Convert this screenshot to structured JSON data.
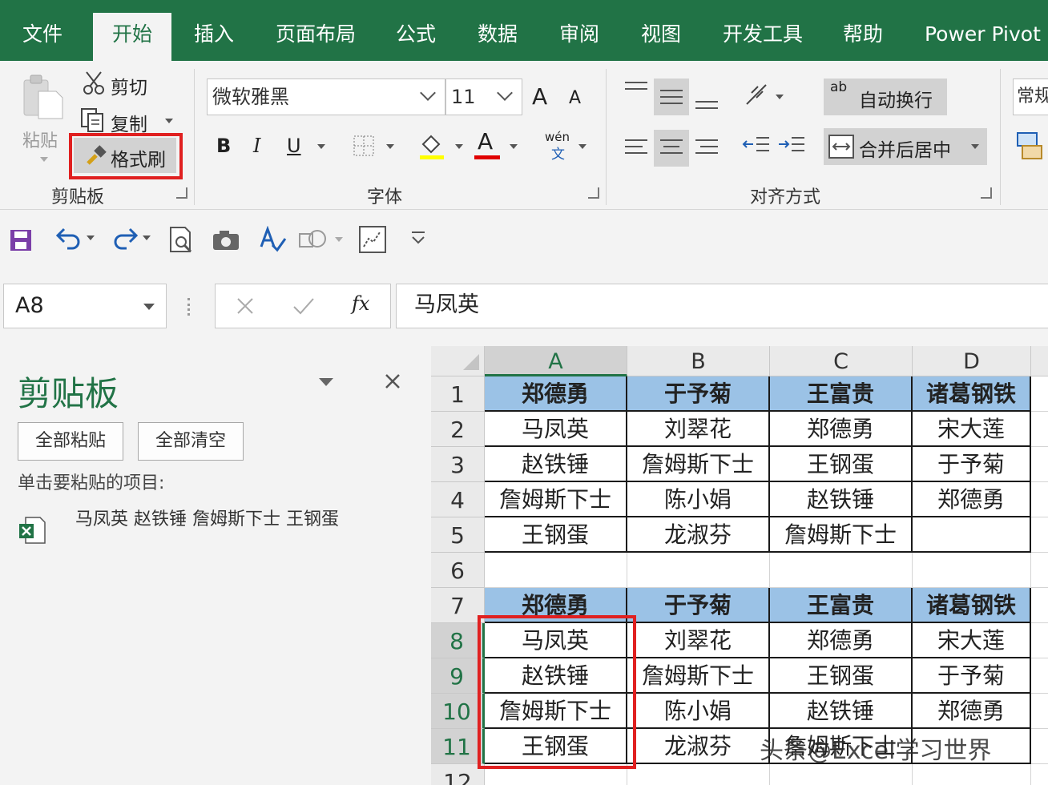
{
  "ribbon_tabs": [
    "文件",
    "开始",
    "插入",
    "页面布局",
    "公式",
    "数据",
    "审阅",
    "视图",
    "开发工具",
    "帮助",
    "Power Pivot"
  ],
  "active_tab": "开始",
  "clipboard_group": {
    "paste_label": "粘贴",
    "cut_label": "剪切",
    "copy_label": "复制",
    "format_painter_label": "格式刷",
    "group_label": "剪贴板"
  },
  "font_group": {
    "font_name": "微软雅黑",
    "font_size": "11",
    "grow_font": "A",
    "shrink_font": "A",
    "bold": "B",
    "italic": "I",
    "underline": "U",
    "phonetic": "wén",
    "phonetic_char": "文",
    "fill_color": "#ffff00",
    "font_color": "#e00000",
    "font_color_letter": "A",
    "group_label": "字体"
  },
  "alignment_group": {
    "wrap_text_label": "自动换行",
    "wrap_icon_text": "ab",
    "merge_center_label": "合并后居中",
    "group_label": "对齐方式"
  },
  "number_group": {
    "format_label": "常规"
  },
  "name_box": "A8",
  "formula_bar": {
    "fx_label": "fx",
    "value": "马凤英"
  },
  "clipboard_pane": {
    "title": "剪贴板",
    "paste_all_button": "全部粘贴",
    "clear_all_button": "全部清空",
    "hint": "单击要粘贴的项目:",
    "items": [
      {
        "text": "马凤英 赵铁锤 詹姆斯下士 王钢蛋"
      }
    ]
  },
  "sheet": {
    "columns": [
      "A",
      "B",
      "C",
      "D"
    ],
    "rows": [
      {
        "num": "1",
        "cells": [
          "郑德勇",
          "于予菊",
          "王富贵",
          "诸葛钢铁"
        ],
        "header": true
      },
      {
        "num": "2",
        "cells": [
          "马凤英",
          "刘翠花",
          "郑德勇",
          "宋大莲"
        ]
      },
      {
        "num": "3",
        "cells": [
          "赵铁锤",
          "詹姆斯下士",
          "王钢蛋",
          "于予菊"
        ]
      },
      {
        "num": "4",
        "cells": [
          "詹姆斯下士",
          "陈小娟",
          "赵铁锤",
          "郑德勇"
        ]
      },
      {
        "num": "5",
        "cells": [
          "王钢蛋",
          "龙淑芬",
          "詹姆斯下士",
          ""
        ]
      },
      {
        "num": "6",
        "cells": [
          "",
          "",
          "",
          ""
        ]
      },
      {
        "num": "7",
        "cells": [
          "郑德勇",
          "于予菊",
          "王富贵",
          "诸葛钢铁"
        ],
        "header": true
      },
      {
        "num": "8",
        "cells": [
          "马凤英",
          "刘翠花",
          "郑德勇",
          "宋大莲"
        ]
      },
      {
        "num": "9",
        "cells": [
          "赵铁锤",
          "詹姆斯下士",
          "王钢蛋",
          "于予菊"
        ]
      },
      {
        "num": "10",
        "cells": [
          "詹姆斯下士",
          "陈小娟",
          "赵铁锤",
          "郑德勇"
        ]
      },
      {
        "num": "11",
        "cells": [
          "王钢蛋",
          "龙淑芬",
          "詹姆斯下士",
          ""
        ]
      },
      {
        "num": "12",
        "cells": [
          "",
          "",
          "",
          ""
        ]
      }
    ],
    "header_fill": "#9bc2e6",
    "selected_range": "A8:A11"
  },
  "watermark": "头条@Excel学习世界",
  "accent_color": "#217346",
  "highlight_color": "#e02020"
}
